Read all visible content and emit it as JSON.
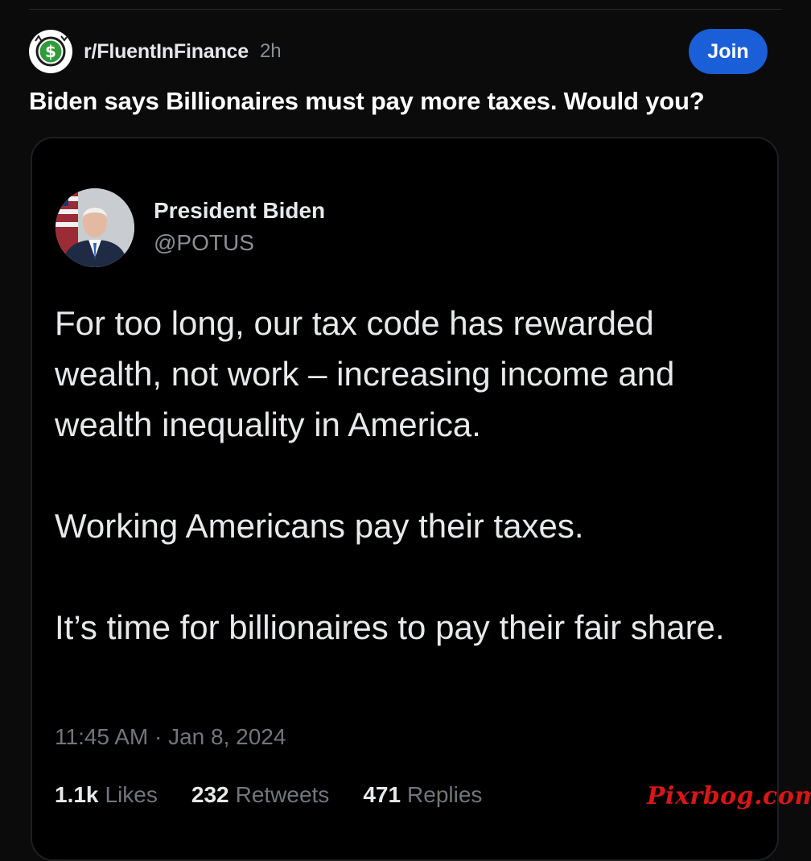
{
  "post": {
    "subreddit": "r/FluentInFinance",
    "age": "2h",
    "join_label": "Join",
    "title": "Biden says Billionaires must pay more taxes. Would you?",
    "subreddit_icon": "dollar-sign-icon"
  },
  "tweet": {
    "display_name": "President Biden",
    "handle": "@POTUS",
    "paragraphs": [
      "For too long, our tax code has rewarded wealth, not work – increasing income and wealth inequality in America.",
      "Working Americans pay their taxes.",
      "It’s time for billionaires to pay their fair share."
    ],
    "timestamp": "11:45 AM · Jan 8, 2024",
    "stats": {
      "likes_count": "1.1k",
      "likes_label": "Likes",
      "retweets_count": "232",
      "retweets_label": "Retweets",
      "replies_count": "471",
      "replies_label": "Replies"
    }
  },
  "watermark": "Pixrbog.com",
  "colors": {
    "background": "#0b0b0c",
    "join_button": "#1a5fd7",
    "watermark": "#d81616"
  }
}
